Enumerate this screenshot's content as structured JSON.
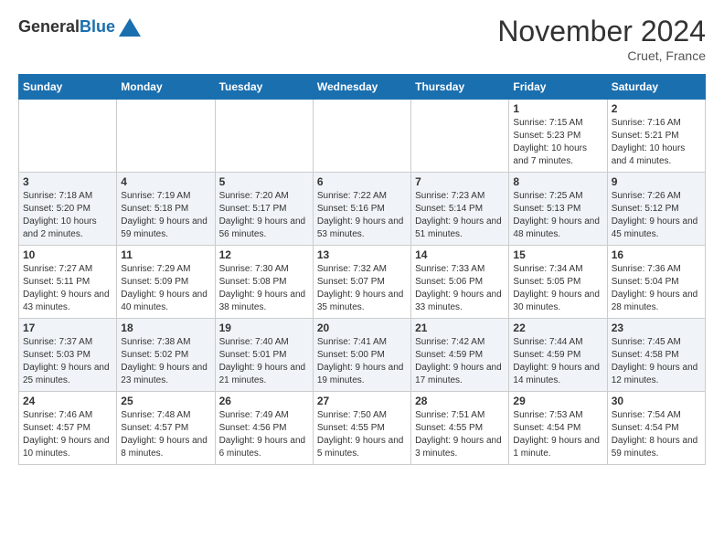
{
  "header": {
    "logo_general": "General",
    "logo_blue": "Blue",
    "month_title": "November 2024",
    "location": "Cruet, France"
  },
  "weekdays": [
    "Sunday",
    "Monday",
    "Tuesday",
    "Wednesday",
    "Thursday",
    "Friday",
    "Saturday"
  ],
  "weeks": [
    [
      {
        "day": "",
        "sunrise": "",
        "sunset": "",
        "daylight": ""
      },
      {
        "day": "",
        "sunrise": "",
        "sunset": "",
        "daylight": ""
      },
      {
        "day": "",
        "sunrise": "",
        "sunset": "",
        "daylight": ""
      },
      {
        "day": "",
        "sunrise": "",
        "sunset": "",
        "daylight": ""
      },
      {
        "day": "",
        "sunrise": "",
        "sunset": "",
        "daylight": ""
      },
      {
        "day": "1",
        "sunrise": "Sunrise: 7:15 AM",
        "sunset": "Sunset: 5:23 PM",
        "daylight": "Daylight: 10 hours and 7 minutes."
      },
      {
        "day": "2",
        "sunrise": "Sunrise: 7:16 AM",
        "sunset": "Sunset: 5:21 PM",
        "daylight": "Daylight: 10 hours and 4 minutes."
      }
    ],
    [
      {
        "day": "3",
        "sunrise": "Sunrise: 7:18 AM",
        "sunset": "Sunset: 5:20 PM",
        "daylight": "Daylight: 10 hours and 2 minutes."
      },
      {
        "day": "4",
        "sunrise": "Sunrise: 7:19 AM",
        "sunset": "Sunset: 5:18 PM",
        "daylight": "Daylight: 9 hours and 59 minutes."
      },
      {
        "day": "5",
        "sunrise": "Sunrise: 7:20 AM",
        "sunset": "Sunset: 5:17 PM",
        "daylight": "Daylight: 9 hours and 56 minutes."
      },
      {
        "day": "6",
        "sunrise": "Sunrise: 7:22 AM",
        "sunset": "Sunset: 5:16 PM",
        "daylight": "Daylight: 9 hours and 53 minutes."
      },
      {
        "day": "7",
        "sunrise": "Sunrise: 7:23 AM",
        "sunset": "Sunset: 5:14 PM",
        "daylight": "Daylight: 9 hours and 51 minutes."
      },
      {
        "day": "8",
        "sunrise": "Sunrise: 7:25 AM",
        "sunset": "Sunset: 5:13 PM",
        "daylight": "Daylight: 9 hours and 48 minutes."
      },
      {
        "day": "9",
        "sunrise": "Sunrise: 7:26 AM",
        "sunset": "Sunset: 5:12 PM",
        "daylight": "Daylight: 9 hours and 45 minutes."
      }
    ],
    [
      {
        "day": "10",
        "sunrise": "Sunrise: 7:27 AM",
        "sunset": "Sunset: 5:11 PM",
        "daylight": "Daylight: 9 hours and 43 minutes."
      },
      {
        "day": "11",
        "sunrise": "Sunrise: 7:29 AM",
        "sunset": "Sunset: 5:09 PM",
        "daylight": "Daylight: 9 hours and 40 minutes."
      },
      {
        "day": "12",
        "sunrise": "Sunrise: 7:30 AM",
        "sunset": "Sunset: 5:08 PM",
        "daylight": "Daylight: 9 hours and 38 minutes."
      },
      {
        "day": "13",
        "sunrise": "Sunrise: 7:32 AM",
        "sunset": "Sunset: 5:07 PM",
        "daylight": "Daylight: 9 hours and 35 minutes."
      },
      {
        "day": "14",
        "sunrise": "Sunrise: 7:33 AM",
        "sunset": "Sunset: 5:06 PM",
        "daylight": "Daylight: 9 hours and 33 minutes."
      },
      {
        "day": "15",
        "sunrise": "Sunrise: 7:34 AM",
        "sunset": "Sunset: 5:05 PM",
        "daylight": "Daylight: 9 hours and 30 minutes."
      },
      {
        "day": "16",
        "sunrise": "Sunrise: 7:36 AM",
        "sunset": "Sunset: 5:04 PM",
        "daylight": "Daylight: 9 hours and 28 minutes."
      }
    ],
    [
      {
        "day": "17",
        "sunrise": "Sunrise: 7:37 AM",
        "sunset": "Sunset: 5:03 PM",
        "daylight": "Daylight: 9 hours and 25 minutes."
      },
      {
        "day": "18",
        "sunrise": "Sunrise: 7:38 AM",
        "sunset": "Sunset: 5:02 PM",
        "daylight": "Daylight: 9 hours and 23 minutes."
      },
      {
        "day": "19",
        "sunrise": "Sunrise: 7:40 AM",
        "sunset": "Sunset: 5:01 PM",
        "daylight": "Daylight: 9 hours and 21 minutes."
      },
      {
        "day": "20",
        "sunrise": "Sunrise: 7:41 AM",
        "sunset": "Sunset: 5:00 PM",
        "daylight": "Daylight: 9 hours and 19 minutes."
      },
      {
        "day": "21",
        "sunrise": "Sunrise: 7:42 AM",
        "sunset": "Sunset: 4:59 PM",
        "daylight": "Daylight: 9 hours and 17 minutes."
      },
      {
        "day": "22",
        "sunrise": "Sunrise: 7:44 AM",
        "sunset": "Sunset: 4:59 PM",
        "daylight": "Daylight: 9 hours and 14 minutes."
      },
      {
        "day": "23",
        "sunrise": "Sunrise: 7:45 AM",
        "sunset": "Sunset: 4:58 PM",
        "daylight": "Daylight: 9 hours and 12 minutes."
      }
    ],
    [
      {
        "day": "24",
        "sunrise": "Sunrise: 7:46 AM",
        "sunset": "Sunset: 4:57 PM",
        "daylight": "Daylight: 9 hours and 10 minutes."
      },
      {
        "day": "25",
        "sunrise": "Sunrise: 7:48 AM",
        "sunset": "Sunset: 4:57 PM",
        "daylight": "Daylight: 9 hours and 8 minutes."
      },
      {
        "day": "26",
        "sunrise": "Sunrise: 7:49 AM",
        "sunset": "Sunset: 4:56 PM",
        "daylight": "Daylight: 9 hours and 6 minutes."
      },
      {
        "day": "27",
        "sunrise": "Sunrise: 7:50 AM",
        "sunset": "Sunset: 4:55 PM",
        "daylight": "Daylight: 9 hours and 5 minutes."
      },
      {
        "day": "28",
        "sunrise": "Sunrise: 7:51 AM",
        "sunset": "Sunset: 4:55 PM",
        "daylight": "Daylight: 9 hours and 3 minutes."
      },
      {
        "day": "29",
        "sunrise": "Sunrise: 7:53 AM",
        "sunset": "Sunset: 4:54 PM",
        "daylight": "Daylight: 9 hours and 1 minute."
      },
      {
        "day": "30",
        "sunrise": "Sunrise: 7:54 AM",
        "sunset": "Sunset: 4:54 PM",
        "daylight": "Daylight: 8 hours and 59 minutes."
      }
    ]
  ]
}
